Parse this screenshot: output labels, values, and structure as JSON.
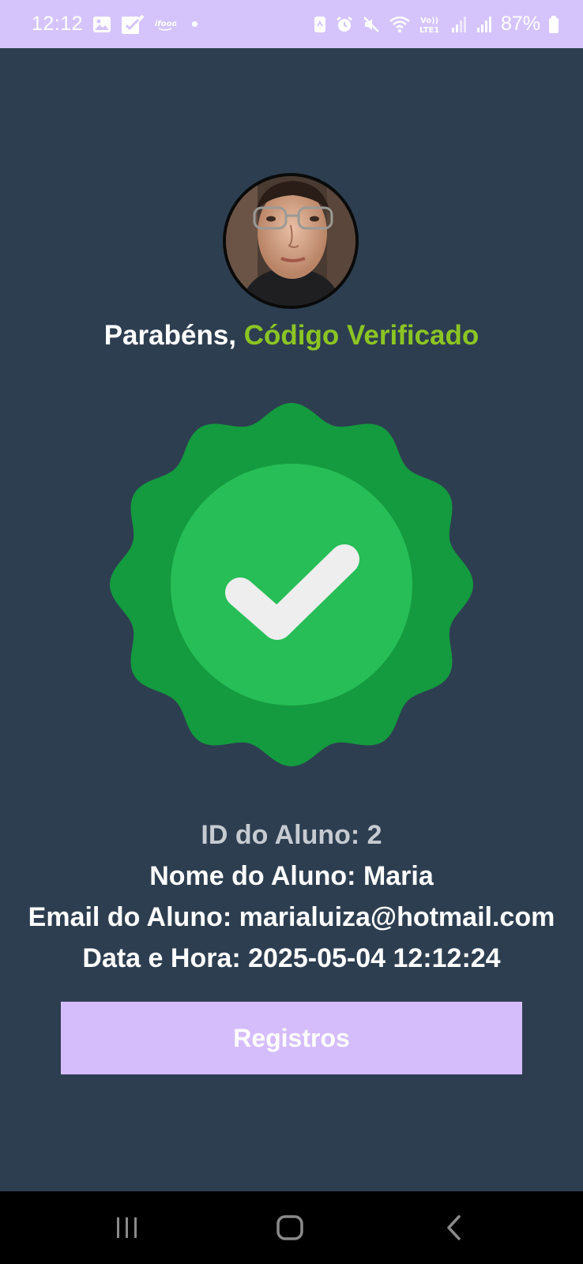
{
  "status_bar": {
    "time": "12:12",
    "battery_percent": "87%",
    "icons": [
      "gallery-icon",
      "check-app-icon",
      "ifood-icon",
      "notification-dot-icon",
      "nfc-icon",
      "alarm-icon",
      "mute-icon",
      "wifi-icon",
      "volte-lte-icon",
      "signal-icon",
      "signal-icon",
      "battery-icon"
    ],
    "volte_label": "Vo)) LTE1"
  },
  "profile": {
    "avatar": "profile-photo"
  },
  "greeting": {
    "prefix": "Parabéns, ",
    "highlight": "Código Verificado",
    "highlight_color": "#8cc523"
  },
  "badge": {
    "icon": "verified-check-badge-icon",
    "outer_color": "#149a3f",
    "inner_color": "#27be57",
    "check_color": "#eeeeee"
  },
  "student": {
    "id_line": "ID do Aluno: 2",
    "name_line": "Nome do Aluno: Maria",
    "email_line": "Email do Aluno: marialuiza@hotmail.com",
    "datetime_line": "Data e Hora: 2025-05-04 12:12:24"
  },
  "actions": {
    "registros_label": "Registros",
    "button_color": "#d5bdfc"
  },
  "nav": {
    "items": [
      "recent-apps-icon",
      "home-icon",
      "back-icon"
    ]
  },
  "colors": {
    "background": "#2d3e50",
    "status_bar": "#d5c4fb"
  }
}
